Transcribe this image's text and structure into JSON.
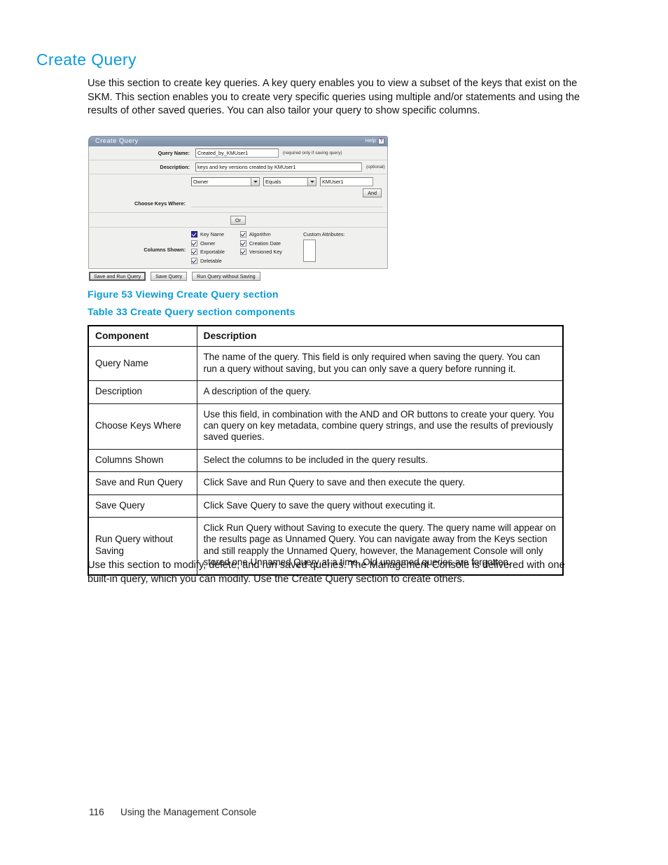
{
  "page": {
    "heading": "Create Query",
    "intro_paragraph": "Use this section to create key queries.  A key query enables you to view a subset of the keys that exist on the SKM. This section enables you to create very specific queries using multiple and/or statements and using the results of other saved queries.  You can also tailor your query to show specific columns.",
    "outro_paragraph": "Use this section to modify, delete, and run saved queries.  The Management Console is delivered with one built-in query, which you can modify.  Use the Create Query section to create others."
  },
  "figure": {
    "caption": "Figure 53 Viewing Create Query section",
    "panel": {
      "title": "Create Query",
      "help_label": "Help",
      "help_icon_glyph": "?",
      "fields": {
        "query_name": {
          "label": "Query Name:",
          "value": "Created_by_KMUser1",
          "hint": "(required only if saving query)"
        },
        "description": {
          "label": "Description:",
          "value": "keys and key versions created by KMUser1",
          "hint": "(optional)"
        },
        "choose_keys_where": {
          "label": "Choose Keys Where:",
          "field_select": "Owner",
          "operator_select": "Equals",
          "value": "KMUser1",
          "and_button": "And",
          "or_button": "Or"
        },
        "columns_shown": {
          "label": "Columns Shown:",
          "group_1": [
            {
              "label": "Key Name",
              "checked": true,
              "focused": true
            },
            {
              "label": "Owner",
              "checked": true,
              "focused": false
            },
            {
              "label": "Exportable",
              "checked": true,
              "focused": false
            },
            {
              "label": "Deletable",
              "checked": true,
              "focused": false
            }
          ],
          "group_2": [
            {
              "label": "Algorithm",
              "checked": true,
              "focused": false
            },
            {
              "label": "Creation Date",
              "checked": true,
              "focused": false
            },
            {
              "label": "Versioned Key",
              "checked": true,
              "focused": false
            }
          ],
          "custom_attributes_label": "Custom Attributes:"
        }
      },
      "buttons": {
        "save_and_run": "Save and Run Query",
        "save": "Save Query",
        "run_without_saving": "Run Query without Saving"
      }
    }
  },
  "table": {
    "caption": "Table 33 Create Query section components",
    "headers": [
      "Component",
      "Description"
    ],
    "rows": [
      {
        "component": "Query Name",
        "description": "The name of the query.  This field is only required when saving the query.  You can run a query without saving, but you can only save a query before running it."
      },
      {
        "component": "Description",
        "description": "A description of the query."
      },
      {
        "component": "Choose Keys Where",
        "description": "Use this field, in combination with the AND and OR buttons to create your query. You can query on key metadata, combine query strings, and use the results of previously saved queries."
      },
      {
        "component": "Columns Shown",
        "description": "Select the columns to be included in the query results."
      },
      {
        "component": "Save and Run Query",
        "description": "Click Save and Run Query to save and then execute the query."
      },
      {
        "component": "Save Query",
        "description": "Click Save Query to save the query without executing it."
      },
      {
        "component": "Run Query without Saving",
        "description": "Click Run Query without Saving to execute the query.  The query name will appear on the results page as Unnamed Query.  You can navigate away from the Keys section and still reapply the Unnamed Query, however, the Management Console will only stored one Unnamed Query at a time.  Old unnamed queries are forgotten."
      }
    ]
  },
  "footer": {
    "page_number": "116",
    "chapter": "Using the Management Console"
  },
  "colors": {
    "heading_blue": "#0b9bd7",
    "caption_blue": "#0b9bd7",
    "titlebar_blue_gray": "#8699b0",
    "panel_background": "#f0f0ef",
    "table_border": "#000000"
  }
}
